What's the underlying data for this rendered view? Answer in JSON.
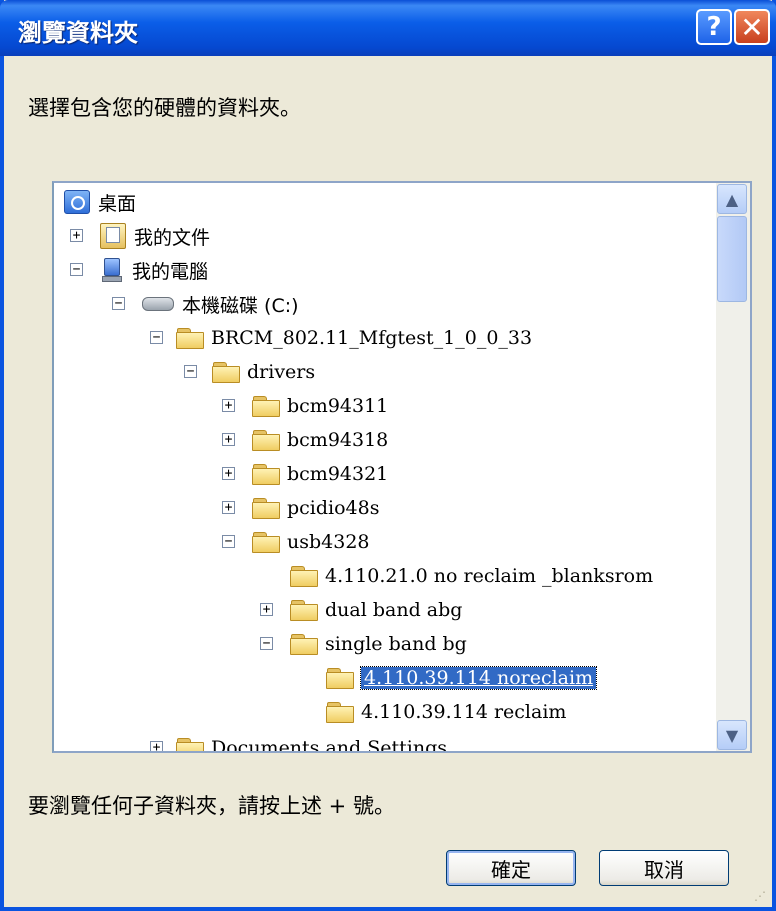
{
  "window": {
    "title": "瀏覽資料夾",
    "help_label": "?",
    "close_label": "✕"
  },
  "instruction": "選擇包含您的硬體的資料夾。",
  "tree": {
    "items": [
      {
        "label": "桌面",
        "icon": "desktop-icon",
        "expander": ""
      },
      {
        "label": "我的文件",
        "icon": "my-documents-icon",
        "expander": "+"
      },
      {
        "label": "我的電腦",
        "icon": "my-computer-icon",
        "expander": "−"
      },
      {
        "label": "本機磁碟 (C:)",
        "icon": "drive-icon",
        "expander": "−"
      },
      {
        "label": "BRCM_802.11_Mfgtest_1_0_0_33",
        "icon": "folder-icon",
        "expander": "−"
      },
      {
        "label": "drivers",
        "icon": "folder-icon",
        "expander": "−"
      },
      {
        "label": "bcm94311",
        "icon": "folder-icon",
        "expander": "+"
      },
      {
        "label": "bcm94318",
        "icon": "folder-icon",
        "expander": "+"
      },
      {
        "label": "bcm94321",
        "icon": "folder-icon",
        "expander": "+"
      },
      {
        "label": "pcidio48s",
        "icon": "folder-icon",
        "expander": "+"
      },
      {
        "label": "usb4328",
        "icon": "folder-icon",
        "expander": "−"
      },
      {
        "label": "4.110.21.0 no reclaim _blanksrom",
        "icon": "folder-icon",
        "expander": ""
      },
      {
        "label": "dual band abg",
        "icon": "folder-icon",
        "expander": "+"
      },
      {
        "label": "single band bg",
        "icon": "folder-icon",
        "expander": "−"
      },
      {
        "label": "4.110.39.114 noreclaim",
        "icon": "folder-open-icon",
        "expander": "",
        "selected": true
      },
      {
        "label": "4.110.39.114 reclaim",
        "icon": "folder-icon",
        "expander": ""
      },
      {
        "label": "Documents and Settings",
        "icon": "folder-icon",
        "expander": "+"
      }
    ],
    "scroll_up_icon": "scroll-up-arrow-icon",
    "scroll_down_icon": "scroll-down-arrow-icon"
  },
  "hint": "要瀏覽任何子資料夾，請按上述 + 號。",
  "buttons": {
    "ok": "確定",
    "cancel": "取消"
  }
}
